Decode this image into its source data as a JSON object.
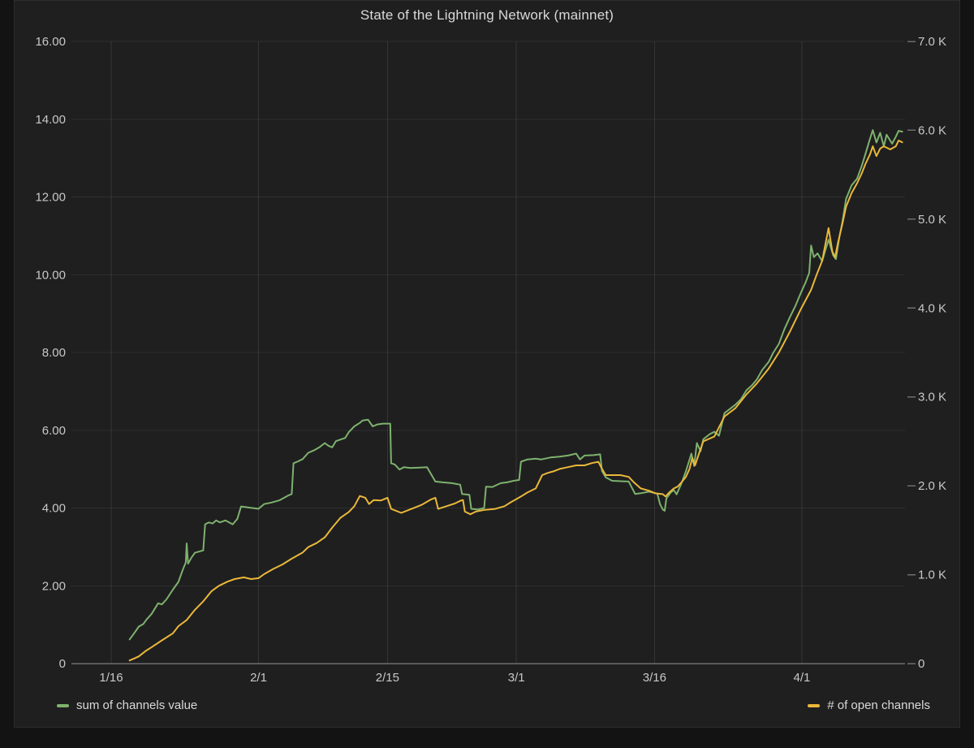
{
  "panel": {
    "title": "State of the Lightning Network (mainnet)"
  },
  "legend": {
    "items": [
      {
        "label": "sum of channels value",
        "color": "#7eb26d"
      },
      {
        "label": "# of open channels",
        "color": "#eab839"
      }
    ]
  },
  "colors": {
    "page_background": "#131314",
    "panel_background": "#1f1f20",
    "green_series": "#7eb26d",
    "yellow_series": "#eab839",
    "tick_text": "#c8c8c9",
    "title_text": "#d8d9da"
  },
  "chart_data": {
    "type": "line",
    "title": "State of the Lightning Network (mainnet)",
    "grid": true,
    "legend_position": "bottom",
    "x_axis": {
      "unit": "days since 1/16",
      "domain": [
        -3.7,
        86.2
      ],
      "ticks": [
        {
          "day": 0,
          "label": "1/16"
        },
        {
          "day": 16,
          "label": "2/1"
        },
        {
          "day": 30,
          "label": "2/15"
        },
        {
          "day": 44,
          "label": "3/1"
        },
        {
          "day": 59,
          "label": "3/16"
        },
        {
          "day": 75,
          "label": "4/1"
        }
      ]
    },
    "y_left": {
      "series": "sum of channels value",
      "domain": [
        0,
        16
      ],
      "ticks": [
        {
          "value": 16,
          "label": "16.00"
        },
        {
          "value": 14,
          "label": "14.00"
        },
        {
          "value": 12,
          "label": "12.00"
        },
        {
          "value": 10,
          "label": "10.00"
        },
        {
          "value": 8,
          "label": "8.00"
        },
        {
          "value": 6,
          "label": "6.00"
        },
        {
          "value": 4,
          "label": "4.00"
        },
        {
          "value": 2,
          "label": "2.00"
        },
        {
          "value": 0,
          "label": "0"
        }
      ]
    },
    "y_right": {
      "series": "# of open channels",
      "domain": [
        0,
        7000
      ],
      "ticks": [
        {
          "value": 7000,
          "label": "7.0 K"
        },
        {
          "value": 6000,
          "label": "6.0 K"
        },
        {
          "value": 5000,
          "label": "5.0 K"
        },
        {
          "value": 4000,
          "label": "4.0 K"
        },
        {
          "value": 3000,
          "label": "3.0 K"
        },
        {
          "value": 2000,
          "label": "2.0 K"
        },
        {
          "value": 1000,
          "label": "1.0 K"
        },
        {
          "value": 0,
          "label": "0"
        }
      ]
    },
    "series": [
      {
        "name": "sum of channels value",
        "color": "#7eb26d",
        "axis": "left",
        "points": [
          [
            2,
            0.62
          ],
          [
            2.5,
            0.78
          ],
          [
            3,
            0.95
          ],
          [
            3.5,
            1.02
          ],
          [
            3.8,
            1.12
          ],
          [
            4.4,
            1.28
          ],
          [
            5.1,
            1.55
          ],
          [
            5.5,
            1.52
          ],
          [
            6,
            1.65
          ],
          [
            6.7,
            1.9
          ],
          [
            7.3,
            2.1
          ],
          [
            7.8,
            2.43
          ],
          [
            8.1,
            2.6
          ],
          [
            8.2,
            3.09
          ],
          [
            8.35,
            2.57
          ],
          [
            8.7,
            2.72
          ],
          [
            9.1,
            2.85
          ],
          [
            10,
            2.91
          ],
          [
            10.2,
            3.58
          ],
          [
            10.6,
            3.63
          ],
          [
            11,
            3.6
          ],
          [
            11.4,
            3.68
          ],
          [
            11.8,
            3.63
          ],
          [
            12.4,
            3.68
          ],
          [
            13.2,
            3.58
          ],
          [
            13.7,
            3.72
          ],
          [
            14.1,
            4.04
          ],
          [
            15,
            4.01
          ],
          [
            16,
            3.98
          ],
          [
            16.6,
            4.1
          ],
          [
            17.4,
            4.14
          ],
          [
            18.3,
            4.2
          ],
          [
            19.2,
            4.32
          ],
          [
            19.6,
            4.36
          ],
          [
            19.8,
            5.15
          ],
          [
            20.3,
            5.2
          ],
          [
            20.8,
            5.26
          ],
          [
            21.4,
            5.42
          ],
          [
            22,
            5.48
          ],
          [
            22.6,
            5.56
          ],
          [
            23.2,
            5.67
          ],
          [
            23.6,
            5.6
          ],
          [
            24,
            5.56
          ],
          [
            24.4,
            5.72
          ],
          [
            24.9,
            5.76
          ],
          [
            25.4,
            5.8
          ],
          [
            25.8,
            5.95
          ],
          [
            26.4,
            6.1
          ],
          [
            27,
            6.19
          ],
          [
            27.3,
            6.25
          ],
          [
            27.9,
            6.27
          ],
          [
            28.4,
            6.1
          ],
          [
            28.9,
            6.15
          ],
          [
            29.5,
            6.17
          ],
          [
            30.3,
            6.17
          ],
          [
            30.4,
            5.15
          ],
          [
            30.8,
            5.12
          ],
          [
            31.3,
            4.99
          ],
          [
            31.8,
            5.05
          ],
          [
            32.5,
            5.03
          ],
          [
            33.5,
            5.04
          ],
          [
            34.3,
            5.05
          ],
          [
            35.2,
            4.68
          ],
          [
            36,
            4.66
          ],
          [
            37,
            4.64
          ],
          [
            37.9,
            4.6
          ],
          [
            38.1,
            4.36
          ],
          [
            38.9,
            4.34
          ],
          [
            39.1,
            3.98
          ],
          [
            39.8,
            3.96
          ],
          [
            40.5,
            4.0
          ],
          [
            40.7,
            4.55
          ],
          [
            41.4,
            4.54
          ],
          [
            42.3,
            4.64
          ],
          [
            43,
            4.66
          ],
          [
            43.7,
            4.7
          ],
          [
            44.3,
            4.72
          ],
          [
            44.5,
            5.19
          ],
          [
            45.2,
            5.25
          ],
          [
            46.1,
            5.27
          ],
          [
            46.7,
            5.25
          ],
          [
            47.7,
            5.3
          ],
          [
            48.7,
            5.32
          ],
          [
            49.6,
            5.35
          ],
          [
            50.5,
            5.4
          ],
          [
            50.9,
            5.25
          ],
          [
            51.4,
            5.35
          ],
          [
            52.4,
            5.36
          ],
          [
            53.1,
            5.38
          ],
          [
            53.3,
            4.95
          ],
          [
            53.7,
            4.79
          ],
          [
            54.4,
            4.7
          ],
          [
            55.3,
            4.69
          ],
          [
            56.2,
            4.68
          ],
          [
            56.9,
            4.36
          ],
          [
            57.5,
            4.38
          ],
          [
            58.4,
            4.42
          ],
          [
            59.3,
            4.37
          ],
          [
            59.6,
            4.1
          ],
          [
            59.9,
            3.96
          ],
          [
            60.1,
            3.93
          ],
          [
            60.3,
            4.25
          ],
          [
            60.8,
            4.41
          ],
          [
            61.1,
            4.46
          ],
          [
            61.4,
            4.35
          ],
          [
            61.9,
            4.62
          ],
          [
            62.4,
            4.94
          ],
          [
            63,
            5.4
          ],
          [
            63.3,
            5.08
          ],
          [
            63.6,
            5.67
          ],
          [
            64,
            5.46
          ],
          [
            64.3,
            5.77
          ],
          [
            65,
            5.9
          ],
          [
            65.5,
            5.96
          ],
          [
            66,
            5.86
          ],
          [
            66.6,
            6.44
          ],
          [
            67.2,
            6.55
          ],
          [
            67.8,
            6.66
          ],
          [
            68.4,
            6.8
          ],
          [
            69,
            7.03
          ],
          [
            69.6,
            7.16
          ],
          [
            70.1,
            7.3
          ],
          [
            70.7,
            7.55
          ],
          [
            71.4,
            7.76
          ],
          [
            71.9,
            8.0
          ],
          [
            72.5,
            8.22
          ],
          [
            73.1,
            8.6
          ],
          [
            73.7,
            8.91
          ],
          [
            74.3,
            9.2
          ],
          [
            74.9,
            9.54
          ],
          [
            75.4,
            9.8
          ],
          [
            75.8,
            10.05
          ],
          [
            76,
            10.75
          ],
          [
            76.3,
            10.45
          ],
          [
            76.7,
            10.55
          ],
          [
            77.2,
            10.35
          ],
          [
            77.9,
            10.9
          ],
          [
            78.4,
            10.5
          ],
          [
            78.7,
            10.4
          ],
          [
            79.1,
            11.0
          ],
          [
            79.4,
            11.35
          ],
          [
            79.8,
            11.95
          ],
          [
            80.4,
            12.3
          ],
          [
            81,
            12.47
          ],
          [
            81.5,
            12.8
          ],
          [
            81.9,
            13.1
          ],
          [
            82.4,
            13.5
          ],
          [
            82.7,
            13.72
          ],
          [
            83.1,
            13.4
          ],
          [
            83.5,
            13.65
          ],
          [
            83.9,
            13.3
          ],
          [
            84.2,
            13.6
          ],
          [
            84.6,
            13.45
          ],
          [
            84.8,
            13.37
          ],
          [
            85.2,
            13.55
          ],
          [
            85.5,
            13.7
          ],
          [
            85.9,
            13.68
          ]
        ]
      },
      {
        "name": "# of open channels",
        "color": "#eab839",
        "axis": "right",
        "points": [
          [
            2,
            35
          ],
          [
            2.5,
            57
          ],
          [
            3,
            80
          ],
          [
            3.8,
            145
          ],
          [
            4.4,
            185
          ],
          [
            5.5,
            260
          ],
          [
            6.7,
            340
          ],
          [
            7.3,
            420
          ],
          [
            8.2,
            490
          ],
          [
            9.1,
            605
          ],
          [
            10,
            700
          ],
          [
            10.9,
            815
          ],
          [
            11.7,
            875
          ],
          [
            12.6,
            920
          ],
          [
            13.4,
            950
          ],
          [
            14.4,
            970
          ],
          [
            15.2,
            950
          ],
          [
            16,
            960
          ],
          [
            16.6,
            1005
          ],
          [
            17.6,
            1065
          ],
          [
            18.6,
            1115
          ],
          [
            19.6,
            1180
          ],
          [
            20.8,
            1250
          ],
          [
            21.4,
            1310
          ],
          [
            22.3,
            1355
          ],
          [
            23.2,
            1420
          ],
          [
            24,
            1530
          ],
          [
            24.9,
            1640
          ],
          [
            25.8,
            1705
          ],
          [
            26.4,
            1770
          ],
          [
            27,
            1885
          ],
          [
            27.6,
            1865
          ],
          [
            28,
            1795
          ],
          [
            28.5,
            1840
          ],
          [
            29.3,
            1835
          ],
          [
            30,
            1865
          ],
          [
            30.4,
            1740
          ],
          [
            31.5,
            1695
          ],
          [
            32.6,
            1740
          ],
          [
            33.7,
            1785
          ],
          [
            34.7,
            1845
          ],
          [
            35.2,
            1865
          ],
          [
            35.5,
            1740
          ],
          [
            36.4,
            1770
          ],
          [
            37.3,
            1800
          ],
          [
            38,
            1835
          ],
          [
            38.2,
            1840
          ],
          [
            38.4,
            1710
          ],
          [
            39,
            1680
          ],
          [
            39.6,
            1710
          ],
          [
            40.6,
            1730
          ],
          [
            41.7,
            1740
          ],
          [
            42.7,
            1770
          ],
          [
            43.4,
            1815
          ],
          [
            44.5,
            1880
          ],
          [
            45.2,
            1925
          ],
          [
            46.1,
            1970
          ],
          [
            46.8,
            2120
          ],
          [
            47.4,
            2145
          ],
          [
            48.1,
            2165
          ],
          [
            48.7,
            2190
          ],
          [
            49.6,
            2210
          ],
          [
            50.5,
            2230
          ],
          [
            51.4,
            2230
          ],
          [
            52.2,
            2255
          ],
          [
            52.9,
            2270
          ],
          [
            53.3,
            2190
          ],
          [
            53.7,
            2120
          ],
          [
            54.4,
            2120
          ],
          [
            55.3,
            2120
          ],
          [
            56.2,
            2100
          ],
          [
            56.8,
            2035
          ],
          [
            57.5,
            1970
          ],
          [
            58.4,
            1945
          ],
          [
            59.1,
            1915
          ],
          [
            59.9,
            1905
          ],
          [
            60.2,
            1880
          ],
          [
            60.6,
            1925
          ],
          [
            61.1,
            1970
          ],
          [
            61.5,
            1990
          ],
          [
            61.9,
            2035
          ],
          [
            62.4,
            2100
          ],
          [
            62.8,
            2190
          ],
          [
            63.1,
            2315
          ],
          [
            63.4,
            2230
          ],
          [
            63.9,
            2385
          ],
          [
            64.3,
            2500
          ],
          [
            65.5,
            2555
          ],
          [
            66.6,
            2780
          ],
          [
            67.8,
            2875
          ],
          [
            69,
            3030
          ],
          [
            70.1,
            3150
          ],
          [
            71.4,
            3320
          ],
          [
            72.5,
            3500
          ],
          [
            73.7,
            3735
          ],
          [
            74.9,
            3990
          ],
          [
            76,
            4205
          ],
          [
            76.6,
            4375
          ],
          [
            77.2,
            4530
          ],
          [
            77.9,
            4900
          ],
          [
            78.3,
            4640
          ],
          [
            78.6,
            4570
          ],
          [
            78.9,
            4725
          ],
          [
            79.4,
            4945
          ],
          [
            79.8,
            5140
          ],
          [
            80.4,
            5295
          ],
          [
            81,
            5405
          ],
          [
            81.5,
            5515
          ],
          [
            81.9,
            5620
          ],
          [
            82.4,
            5730
          ],
          [
            82.7,
            5820
          ],
          [
            83.1,
            5710
          ],
          [
            83.5,
            5795
          ],
          [
            83.9,
            5820
          ],
          [
            84.6,
            5785
          ],
          [
            85.2,
            5820
          ],
          [
            85.5,
            5885
          ],
          [
            85.9,
            5865
          ]
        ]
      }
    ]
  }
}
